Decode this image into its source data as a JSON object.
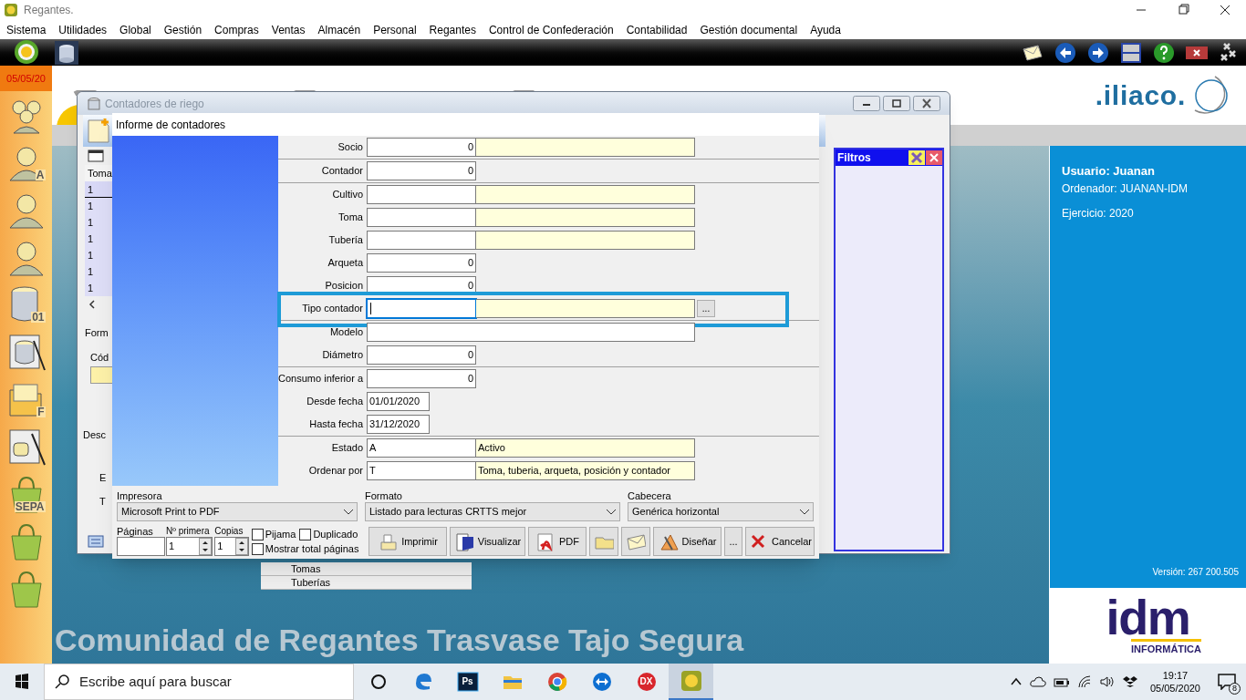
{
  "app": {
    "title": "Regantes.",
    "menu": [
      "Sistema",
      "Utilidades",
      "Global",
      "Gestión",
      "Compras",
      "Ventas",
      "Almacén",
      "Personal",
      "Regantes",
      "Control de Confederación",
      "Contabilidad",
      "Gestión documental",
      "Ayuda"
    ],
    "date": "05/05/20"
  },
  "sidebar": [
    {
      "kind": "people"
    },
    {
      "kind": "person",
      "label": "A"
    },
    {
      "kind": "person"
    },
    {
      "kind": "person"
    },
    {
      "kind": "database",
      "label": "01"
    },
    {
      "kind": "database-wand"
    },
    {
      "kind": "folder",
      "label": "F"
    },
    {
      "kind": "wand"
    },
    {
      "kind": "bag",
      "label": "SEPA"
    },
    {
      "kind": "bag"
    },
    {
      "kind": "bag"
    }
  ],
  "header": {
    "brand": ".iliaco."
  },
  "user_panel": {
    "user": "Usuario: Juanan",
    "computer": "Ordenador: JUANAN-IDM",
    "year": "Ejercicio: 2020",
    "version": "Versión: 267 200.505",
    "logo": "idm",
    "logo_sub": "INFORMÁTICA"
  },
  "banner": "Comunidad de Regantes Trasvase Tajo Segura",
  "back_window": {
    "title": "Contadores de riego",
    "column": "Toma",
    "rows": [
      "1",
      "1",
      "1",
      "1",
      "1",
      "1",
      "1"
    ],
    "labels": [
      "Form",
      "Cód",
      "Desc",
      "E",
      "T"
    ],
    "filters_title": "Filtros"
  },
  "popup_list": [
    "Tomas",
    "Tuberías"
  ],
  "dialog": {
    "title": "Informe de contadores",
    "groups": [
      [
        {
          "label": "Socio",
          "kind": "number_desc",
          "value": "0",
          "focused": false,
          "highlighted": false
        }
      ],
      [
        {
          "label": "Contador",
          "kind": "number",
          "value": "0",
          "focused": false,
          "highlighted": false
        }
      ],
      [
        {
          "label": "Cultivo",
          "kind": "code_desc",
          "focused": false,
          "highlighted": false
        },
        {
          "label": "Toma",
          "kind": "code_desc",
          "focused": false,
          "highlighted": false
        },
        {
          "label": "Tubería",
          "kind": "code_desc",
          "focused": false,
          "highlighted": false
        },
        {
          "label": "Arqueta",
          "kind": "number",
          "value": "0",
          "focused": false,
          "highlighted": false
        },
        {
          "label": "Posicion",
          "kind": "number",
          "value": "0",
          "focused": false,
          "highlighted": false
        },
        {
          "label": "Tipo contador",
          "kind": "code_desc",
          "button": "...",
          "focused": true,
          "highlighted": true
        }
      ],
      [
        {
          "label": "Modelo",
          "kind": "text",
          "focused": false,
          "highlighted": false
        },
        {
          "label": "Diámetro",
          "kind": "number",
          "value": "0",
          "focused": false,
          "highlighted": false
        }
      ],
      [
        {
          "label": "Consumo inferior a",
          "kind": "number",
          "value": "0",
          "focused": false,
          "highlighted": false
        },
        {
          "label": "Desde fecha",
          "kind": "date",
          "value": "01/01/2020",
          "focused": false,
          "highlighted": false
        },
        {
          "label": "Hasta fecha",
          "kind": "date",
          "value": "31/12/2020",
          "focused": false,
          "highlighted": false
        }
      ],
      [
        {
          "label": "Estado",
          "kind": "code_desc",
          "value": "A",
          "desc": "Activo",
          "focused": false,
          "highlighted": false
        },
        {
          "label": "Ordenar por",
          "kind": "code_desc",
          "value": "T",
          "desc": "Toma, tuberia, arqueta, posición y contador",
          "focused": false,
          "highlighted": false
        }
      ]
    ],
    "selects": [
      {
        "label": "Impresora",
        "value": "Microsoft Print to PDF"
      },
      {
        "label": "Formato",
        "value": "Listado para lecturas CRTTS mejor"
      },
      {
        "label": "Cabecera",
        "value": "Genérica horizontal"
      }
    ],
    "pages": {
      "label": "Páginas"
    },
    "spinners": [
      {
        "label": "Nº primera",
        "value": "1"
      },
      {
        "label": "Copias",
        "value": "1"
      }
    ],
    "checkboxes": [
      {
        "label": "Pijama",
        "checked": false
      },
      {
        "label": "Duplicado",
        "checked": false
      },
      {
        "label": "Mostrar total páginas",
        "checked": false
      }
    ],
    "buttons": [
      {
        "kind": "print",
        "label": "Imprimir"
      },
      {
        "kind": "preview",
        "label": "Visualizar"
      },
      {
        "kind": "pdf",
        "label": "PDF"
      },
      {
        "kind": "folder"
      },
      {
        "kind": "mail"
      },
      {
        "kind": "design",
        "label": "Diseñar"
      },
      {
        "kind": "more",
        "label": "..."
      },
      {
        "kind": "cancel",
        "label": "Cancelar"
      }
    ]
  },
  "taskbar": {
    "search_placeholder": "Escribe aquí para buscar",
    "apps": [
      {
        "kind": "cortana",
        "selected": false
      },
      {
        "kind": "edge",
        "selected": false
      },
      {
        "kind": "ps",
        "label": "Ps",
        "selected": false
      },
      {
        "kind": "files",
        "selected": false
      },
      {
        "kind": "chrome",
        "selected": false
      },
      {
        "kind": "teamviewer",
        "selected": false
      },
      {
        "kind": "dx",
        "label": "DX",
        "selected": false
      },
      {
        "kind": "app",
        "selected": true
      }
    ],
    "time": "19:17",
    "date": "05/05/2020",
    "notifications": "8"
  }
}
